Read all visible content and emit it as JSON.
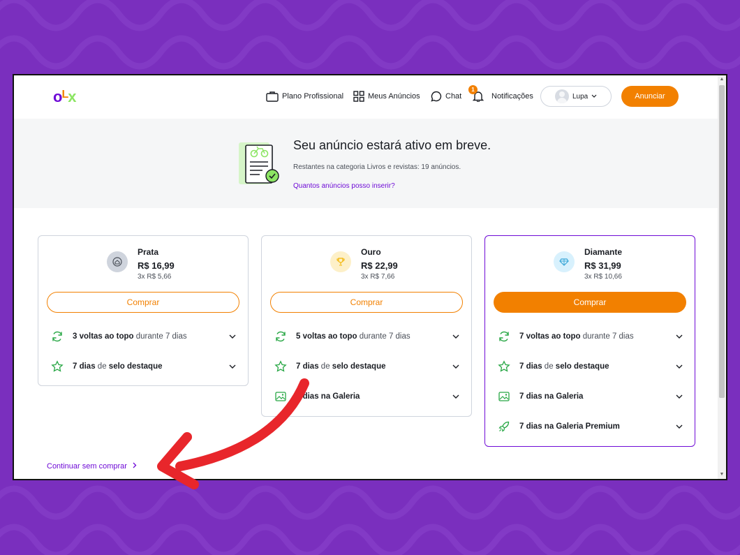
{
  "brand": {
    "logo_o": "o",
    "logo_l": "L",
    "logo_x": "x"
  },
  "header": {
    "nav": [
      {
        "label": "Plano Profissional",
        "icon": "briefcase-icon"
      },
      {
        "label": "Meus Anúncios",
        "icon": "grid-icon"
      },
      {
        "label": "Chat",
        "icon": "chat-bubble-icon"
      },
      {
        "label": "Notificações",
        "icon": "bell-icon"
      }
    ],
    "notification_count": "1",
    "user_name": "Lupa",
    "cta_label": "Anunciar"
  },
  "banner": {
    "title": "Seu anúncio estará ativo em breve.",
    "subtitle": "Restantes na categoria Livros e revistas: 19 anúncios.",
    "link": "Quantos anúncios posso inserir?"
  },
  "plans": [
    {
      "name": "Prata",
      "price": "R$ 16,99",
      "installments": "3x R$ 5,66",
      "button": "Comprar",
      "features": [
        {
          "strong": "3 voltas ao topo",
          "rest": " durante 7 dias"
        },
        {
          "strong": "7 dias",
          "mid": " de ",
          "strong2": "selo destaque"
        }
      ]
    },
    {
      "name": "Ouro",
      "price": "R$ 22,99",
      "installments": "3x R$ 7,66",
      "button": "Comprar",
      "features": [
        {
          "strong": "5 voltas ao topo",
          "rest": " durante 7 dias"
        },
        {
          "strong": "7 dias",
          "mid": " de ",
          "strong2": "selo destaque"
        },
        {
          "strong": "7 dias na Galeria"
        }
      ]
    },
    {
      "name": "Diamante",
      "price": "R$ 31,99",
      "installments": "3x R$ 10,66",
      "button": "Comprar",
      "features": [
        {
          "strong": "7 voltas ao topo",
          "rest": " durante 7 dias"
        },
        {
          "strong": "7 dias",
          "mid": " de ",
          "strong2": "selo destaque"
        },
        {
          "strong": "7 dias na Galeria"
        },
        {
          "strong": "7 dias na Galeria Premium"
        }
      ]
    }
  ],
  "continue_label": "Continuar sem comprar",
  "colors": {
    "brand_purple": "#6e0ad6",
    "brand_orange": "#f28000",
    "brand_green": "#8ce563",
    "background": "#7a2fbe",
    "annotation_red": "#e8262b"
  }
}
